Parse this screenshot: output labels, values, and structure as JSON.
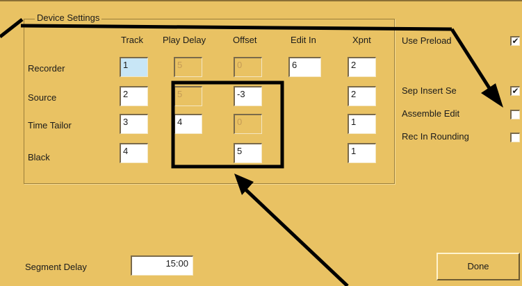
{
  "group_title": "Device Settings",
  "columns": [
    "Track",
    "Play Delay",
    "Offset",
    "Edit In",
    "Xpnt"
  ],
  "rows": [
    {
      "label": "Recorder",
      "track": "1",
      "play_delay": "5",
      "offset": "0",
      "edit_in": "6",
      "xpnt": "2"
    },
    {
      "label": "Source",
      "track": "2",
      "play_delay": "5",
      "offset": "-3",
      "xpnt": "2"
    },
    {
      "label": "Time Tailor",
      "track": "3",
      "play_delay": "4",
      "offset": "0",
      "xpnt": "1"
    },
    {
      "label": "Black",
      "track": "4",
      "offset": "5",
      "xpnt": "1"
    }
  ],
  "options": [
    {
      "label": "Use Preload",
      "visible_label": "Use Preload",
      "checked": true
    },
    {
      "label": "Sep Insert Segs",
      "visible_label": "Sep Insert Se",
      "checked": true
    },
    {
      "label": "Assemble Edit",
      "checked": false
    },
    {
      "label": "Rec In Rounding",
      "checked": false
    }
  ],
  "segment_delay": {
    "label": "Segment Delay",
    "value": "15:00"
  },
  "done_label": "Done",
  "check_glyph": "✔",
  "colors": {
    "panel": "#E9C263",
    "annotation": "#000000",
    "disabled_text": "#c49a55"
  }
}
